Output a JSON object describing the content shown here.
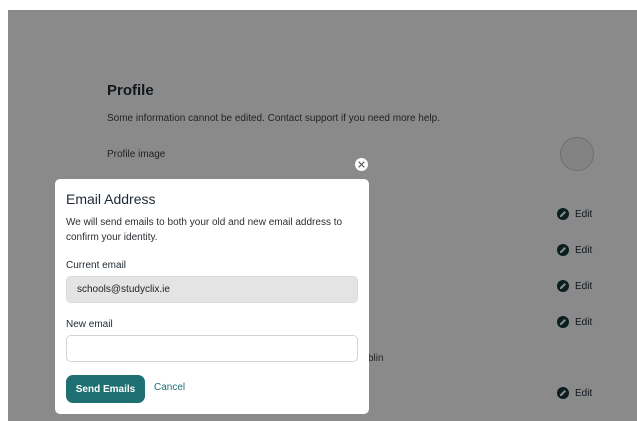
{
  "profile": {
    "title": "Profile",
    "description": "Some information cannot be edited. Contact support if you need more help.",
    "image_label": "Profile image",
    "edit_label": "Edit",
    "partial_location_text": "blin"
  },
  "modal": {
    "title": "Email Address",
    "description": "We will send emails to both your old and new email address to confirm your identity.",
    "current_email_label": "Current email",
    "current_email_value": "schools@studyclix.ie",
    "new_email_label": "New email",
    "new_email_value": "",
    "send_button_label": "Send Emails",
    "cancel_label": "Cancel",
    "close_icon": "close-icon"
  },
  "colors": {
    "accent": "#1d6f72",
    "edit_icon_bg": "#14373a",
    "overlay": "rgba(0,0,0,0.46)"
  }
}
